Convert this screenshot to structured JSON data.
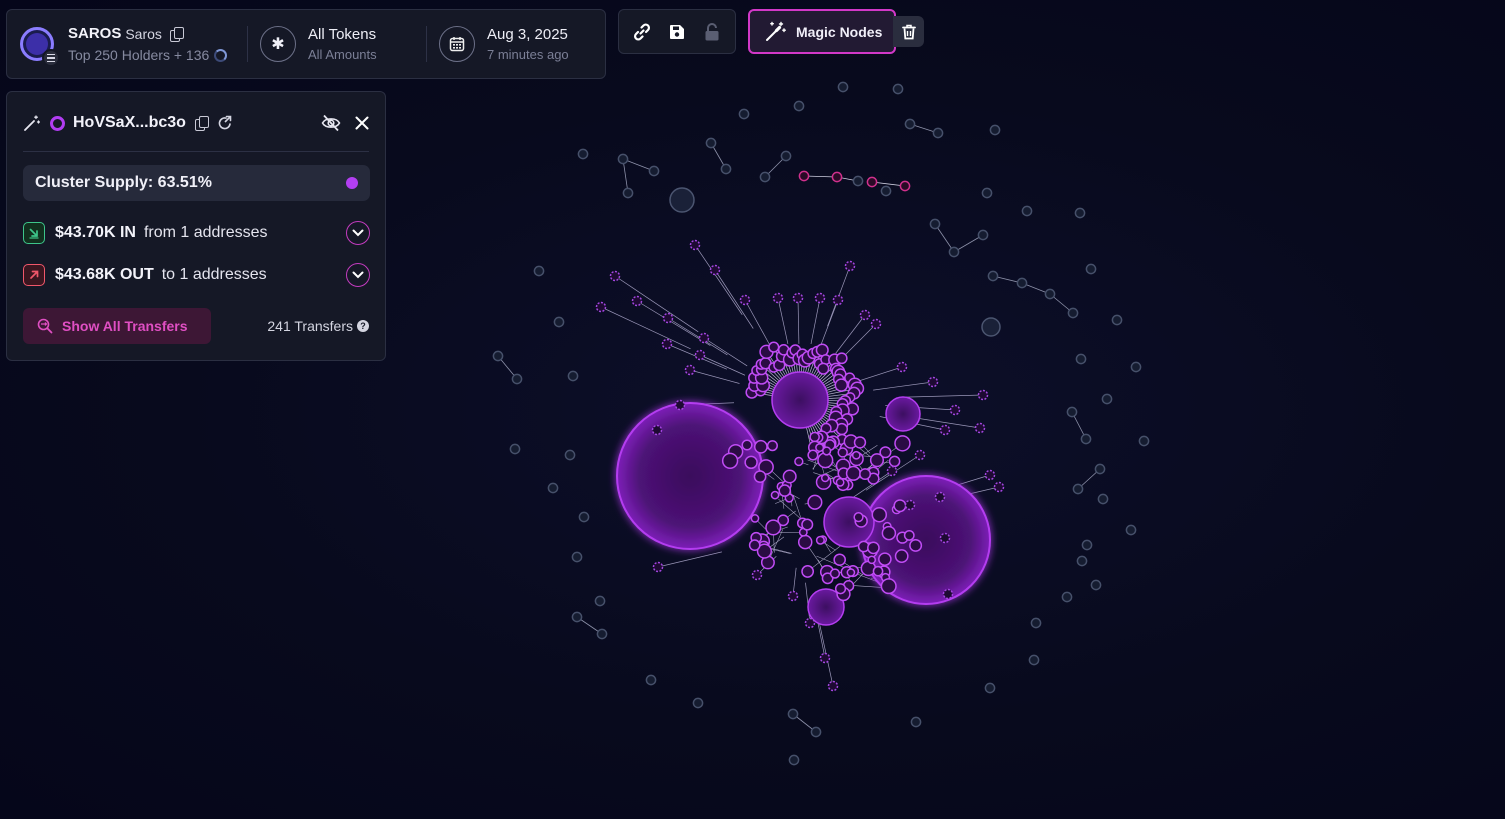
{
  "token": {
    "symbol": "SAROS",
    "name": "Saros",
    "holders_text": "Top 250 Holders + 136"
  },
  "filters": {
    "tokens_label": "All Tokens",
    "amounts_label": "All Amounts",
    "date": "Aug 3, 2025",
    "updated": "7 minutes ago"
  },
  "toolbar": {
    "magic_label": "Magic Nodes"
  },
  "cluster": {
    "address": "HoVSaX...bc3o",
    "supply_label": "Cluster Supply: 63.51%",
    "in_amount": "$43.70K IN",
    "in_desc": "from 1 addresses",
    "out_amount": "$43.68K OUT",
    "out_desc": "to 1 addresses",
    "show_label": "Show All Transfers",
    "transfers_count": "241 Transfers"
  },
  "colors": {
    "accent": "#d238c8",
    "cluster_node": "#b13df2",
    "isolated_node": "#3b4257",
    "in_icon": "#3dc58a",
    "out_icon": "#f0576a",
    "background": "#080a1d"
  }
}
